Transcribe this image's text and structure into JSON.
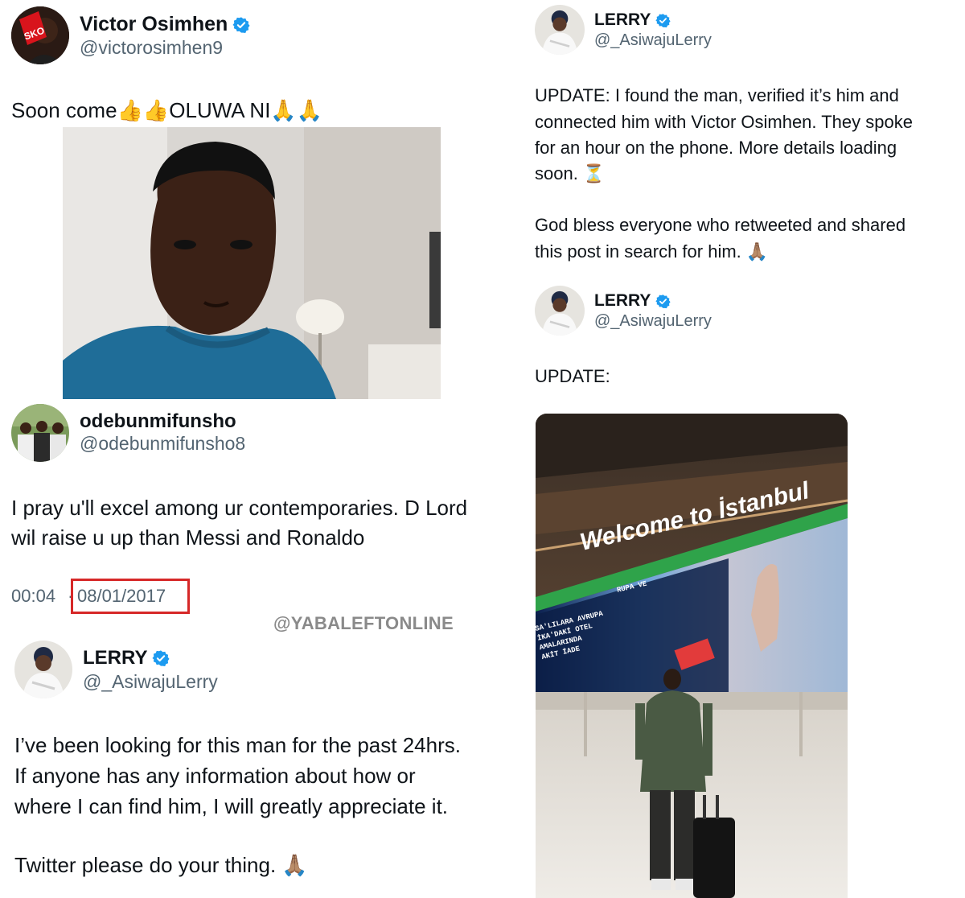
{
  "left_col": {
    "post1": {
      "name": "Victor Osimhen",
      "handle": "@victorosimhen9",
      "text": "Soon come👍👍OLUWA NI🙏🙏",
      "avatar_icon": "avatar-victor-osimhen"
    },
    "post2": {
      "name": "odebunmifunsho",
      "handle": "@odebunmifunsho8",
      "line1": "I pray u'll excel among ur contemporaries. D Lord",
      "line2": "wil raise u up than Messi and Ronaldo",
      "time": "00:04",
      "sep": "·",
      "date": "08/01/2017"
    },
    "watermark": "@YABALEFTONLINE",
    "post3": {
      "name": "LERRY",
      "handle": "@_AsiwajuLerry",
      "line1": "I’ve been looking for this man for the past 24hrs.",
      "line2": "If anyone has any information about how or",
      "line3": "where I can find him, I will greatly appreciate it.",
      "line4": "Twitter please do your thing. 🙏🏽"
    }
  },
  "right_col": {
    "post1": {
      "name": "LERRY",
      "handle": "@_AsiwajuLerry",
      "line1": "UPDATE: I found the man, verified it’s him and",
      "line2": "connected him with Victor Osimhen. They spoke",
      "line3": "for an hour on the phone. More details loading",
      "line4": "soon. ⏳",
      "line5": "God bless everyone who retweeted and shared",
      "line6": "this post in search for him. 🙏🏽"
    },
    "post2": {
      "name": "LERRY",
      "handle": "@_AsiwajuLerry",
      "text": "UPDATE:"
    },
    "photo_sign": "Welcome to İstanbul",
    "screen_text": {
      "line1": "RUPA VE",
      "line2": "SA'LILARA AVRUPA",
      "line3": "İKA'DAKİ OTEL",
      "line4": "AMALARINDA",
      "line5": "AKİT İADE"
    }
  },
  "colors": {
    "verified": "#1d9bf0",
    "name": "#0f1419",
    "handle": "#536471",
    "highlight": "#d62828"
  }
}
